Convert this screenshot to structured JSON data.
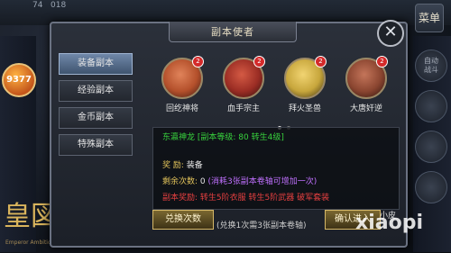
{
  "hud": {
    "level": "74    018",
    "menu_label": "菜单"
  },
  "left_badge": "9377",
  "logo": {
    "main": "皇図",
    "sub": "Emperor Ambition"
  },
  "right_side": [
    "自动\n战斗",
    "",
    "",
    ""
  ],
  "watermark": "xiaopi",
  "dialog": {
    "title": "副本使者",
    "close": "✕",
    "tabs": [
      {
        "label": "装备副本",
        "active": true
      },
      {
        "label": "经验副本",
        "active": false
      },
      {
        "label": "金币副本",
        "active": false
      },
      {
        "label": "特殊副本",
        "active": false
      }
    ],
    "bosses": [
      {
        "name": "回纥神将",
        "count": "2",
        "color": "#b4502b"
      },
      {
        "name": "血手宗主",
        "count": "2",
        "color": "#9b2d24"
      },
      {
        "name": "拜火圣兽",
        "count": "2",
        "color": "#c7a63c"
      },
      {
        "name": "大唐奸逆",
        "count": "2",
        "color": "#8a4530"
      }
    ],
    "pager": {
      "pages": 2,
      "current": 0
    },
    "info": {
      "boss_name": "东瀛神龙",
      "level_text": "[副本等级: 80 转生4级]",
      "reward_label": "奖  励:",
      "reward_value": "装备",
      "remaining_label": "剩余次数:",
      "remaining_value": "0",
      "remaining_note": "(消耗3张副本卷轴可增加一次)",
      "drops_label": "副本奖励:",
      "drops_value": "转生5阶衣服 转生5阶武器 破军套装"
    },
    "exchange_button": "兑换次数",
    "exchange_note": "(兑换1次需3张副本卷轴)",
    "confirm_button": "确认进入",
    "player_name": "小皮"
  }
}
